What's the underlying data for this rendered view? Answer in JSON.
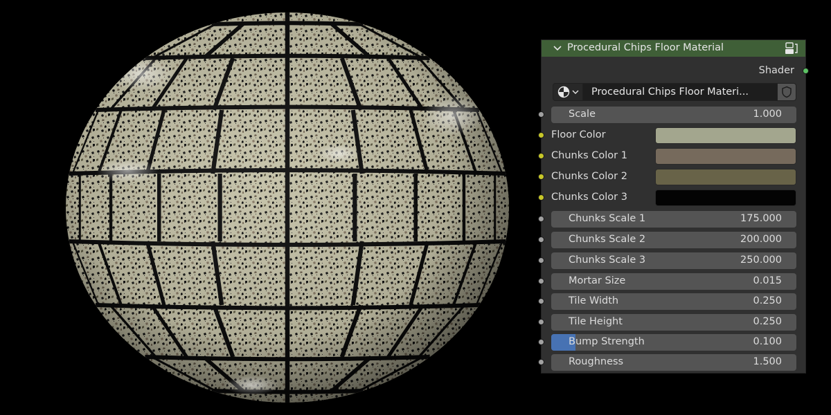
{
  "node": {
    "title": "Procedural Chips Floor Material",
    "output_label": "Shader",
    "header_color": "#3f5f37",
    "collapse_icon": "chevron-down-icon",
    "group_icon": "node-group-icon",
    "datablock": {
      "type_icon": "node-tree-icon",
      "name": "Procedural Chips Floor Materi...",
      "fake_user_icon": "shield-icon"
    },
    "inputs": [
      {
        "label": "Scale",
        "value": "1.000"
      },
      {
        "label": "Floor Color",
        "color": "#a3a68e"
      },
      {
        "label": "Chunks Color 1",
        "color": "#766a5c"
      },
      {
        "label": "Chunks Color 2",
        "color": "#686348"
      },
      {
        "label": "Chunks Color 3",
        "color": "#030303"
      },
      {
        "label": "Chunks Scale 1",
        "value": "175.000"
      },
      {
        "label": "Chunks Scale 2",
        "value": "200.000"
      },
      {
        "label": "Chunks Scale 3",
        "value": "250.000"
      },
      {
        "label": "Mortar Size",
        "value": "0.015"
      },
      {
        "label": "Tile Width",
        "value": "0.250"
      },
      {
        "label": "Tile Height",
        "value": "0.250"
      },
      {
        "label": "Bump Strength",
        "value": "0.100",
        "slider_fraction": 0.1
      },
      {
        "label": "Roughness",
        "value": "1.500"
      }
    ]
  },
  "preview": {
    "object": "sphere",
    "material_base_color": "#b9b69d",
    "grout_color": "#0c0c0c"
  }
}
